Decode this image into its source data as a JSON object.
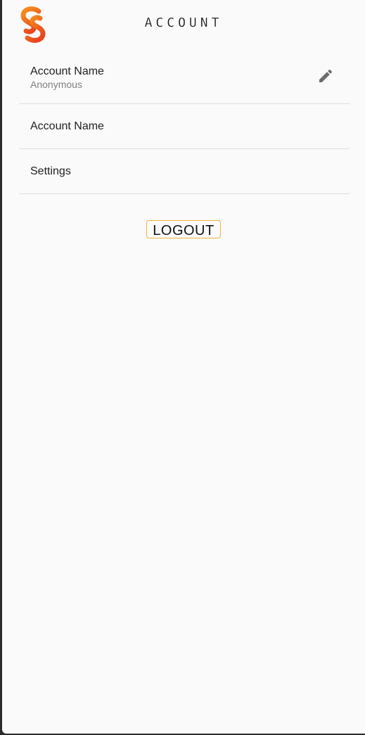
{
  "header": {
    "title": "ACCOUNT",
    "logo": "app-logo",
    "logo_colors": [
      "#f7931e",
      "#e8451e"
    ]
  },
  "list": {
    "items": [
      {
        "label": "Account Name",
        "subtitle": "Anonymous",
        "icon": "pencil-icon"
      },
      {
        "label": "Account Name"
      },
      {
        "label": "Settings"
      }
    ]
  },
  "actions": {
    "logout_label": "LOGOUT",
    "accent": "#f2b13a"
  }
}
